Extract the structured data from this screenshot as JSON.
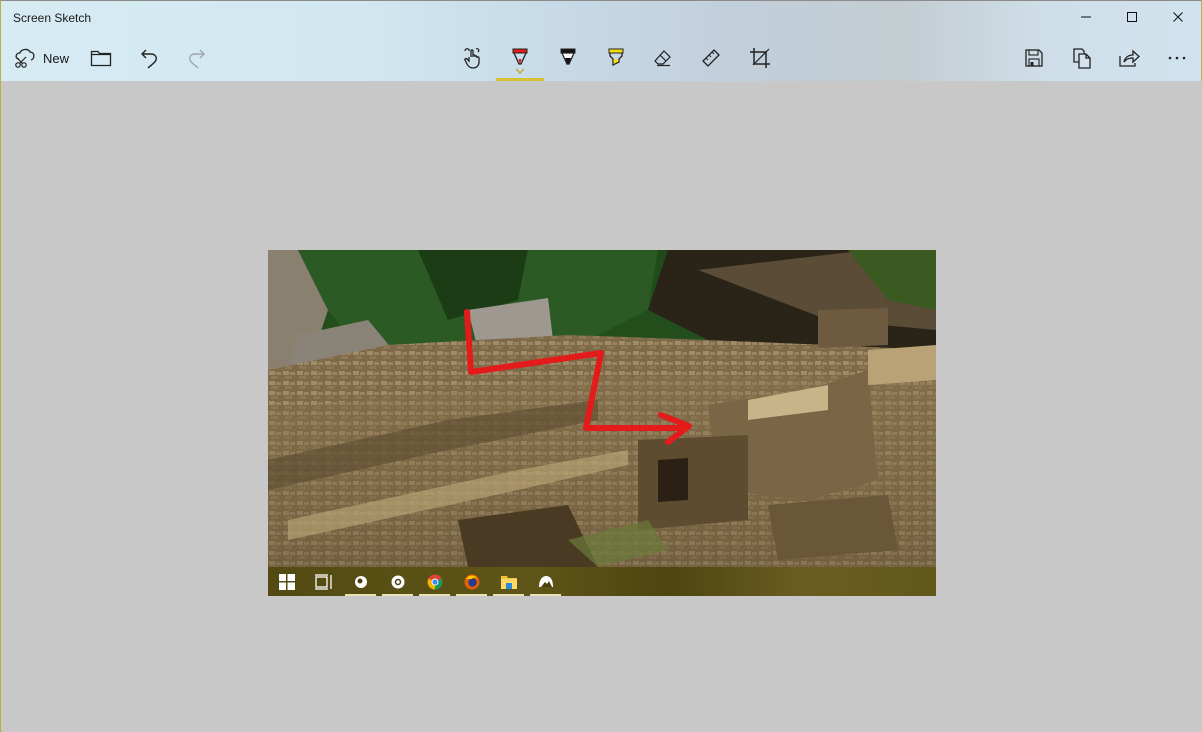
{
  "window": {
    "title": "Screen Sketch",
    "caption_buttons": [
      {
        "name": "minimize",
        "icon": "minimize-icon"
      },
      {
        "name": "maximize",
        "icon": "maximize-icon"
      },
      {
        "name": "close",
        "icon": "close-icon"
      }
    ]
  },
  "toolbar": {
    "new_label": "New",
    "left_tools": [
      {
        "name": "new",
        "label": "New",
        "icon": "new-snip-icon"
      },
      {
        "name": "open",
        "icon": "folder-icon"
      },
      {
        "name": "undo",
        "icon": "undo-icon"
      },
      {
        "name": "redo",
        "icon": "redo-icon",
        "enabled": false
      }
    ],
    "center_tools": [
      {
        "name": "touch-writing",
        "icon": "touch-writing-icon"
      },
      {
        "name": "ballpoint-pen",
        "icon": "ballpoint-pen-icon",
        "color": "#e31b1b",
        "selected": true
      },
      {
        "name": "pencil",
        "icon": "pencil-icon",
        "color": "#111111"
      },
      {
        "name": "highlighter",
        "icon": "highlighter-icon",
        "color": "#f5dd10"
      },
      {
        "name": "eraser",
        "icon": "eraser-icon"
      },
      {
        "name": "ruler",
        "icon": "ruler-icon"
      },
      {
        "name": "crop",
        "icon": "crop-icon"
      }
    ],
    "right_tools": [
      {
        "name": "save",
        "icon": "save-icon"
      },
      {
        "name": "copy",
        "icon": "copy-icon"
      },
      {
        "name": "share",
        "icon": "share-icon"
      },
      {
        "name": "more",
        "icon": "more-icon"
      }
    ],
    "accent_color": "#d6c232"
  },
  "canvas": {
    "background": "#c8c8c8",
    "screenshot": {
      "description": "Machu Picchu stone ruins with red ink arrow annotation",
      "annotation_color": "#e31b1b",
      "taskbar_icons": [
        {
          "name": "start",
          "icon": "windows-start-icon",
          "running": false
        },
        {
          "name": "task-view",
          "icon": "task-view-icon",
          "running": false
        },
        {
          "name": "app-1",
          "icon": "app-icon",
          "running": true
        },
        {
          "name": "app-2",
          "icon": "settings-app-icon",
          "running": true
        },
        {
          "name": "chrome",
          "icon": "chrome-icon",
          "running": true
        },
        {
          "name": "firefox",
          "icon": "firefox-icon",
          "running": true
        },
        {
          "name": "file-explorer",
          "icon": "file-explorer-icon",
          "running": true
        },
        {
          "name": "photos",
          "icon": "photos-icon",
          "running": true
        }
      ]
    }
  }
}
